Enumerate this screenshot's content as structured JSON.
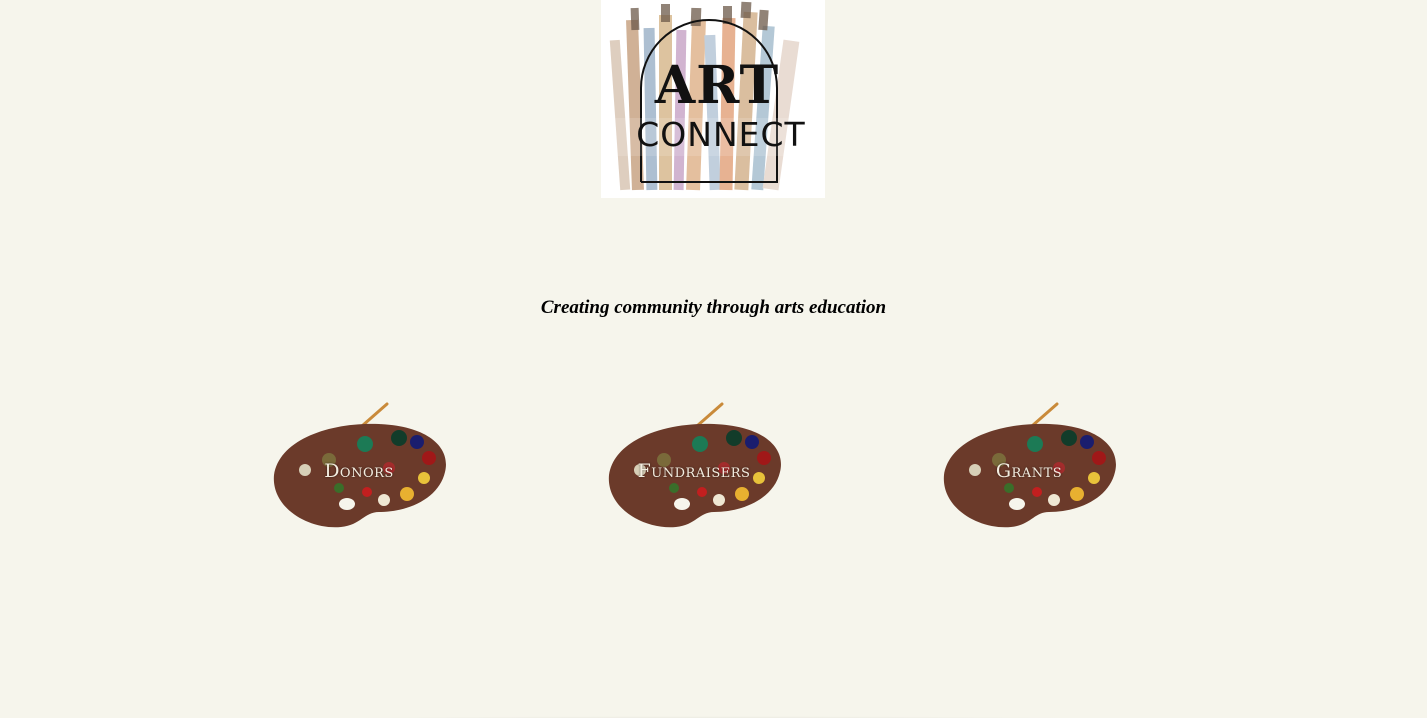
{
  "brand": {
    "logo_line1": "ART",
    "logo_line2": "CONNECT"
  },
  "tagline": "Creating community through arts education",
  "nav": [
    {
      "label": "Donors"
    },
    {
      "label": "Fundraisers"
    },
    {
      "label": "Grants"
    }
  ],
  "colors": {
    "background": "#f6f5ec",
    "logo_background": "#ffffff",
    "palette_wood": "#6b3a2a",
    "label_text": "#f3ede0"
  },
  "icons": {
    "logo_art": "paint-brushes-image",
    "nav_item": "artist-palette-icon"
  }
}
